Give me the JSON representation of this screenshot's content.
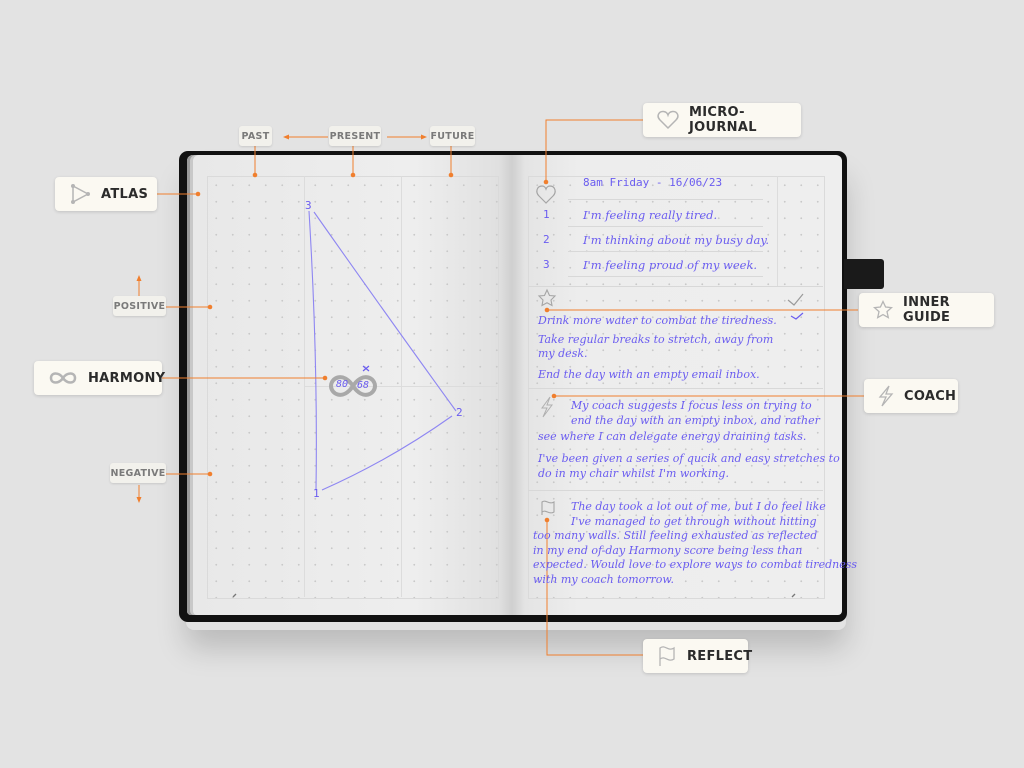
{
  "colors": {
    "accent": "#f07f2e",
    "ink": "#6a5cf0",
    "cover": "#111111",
    "label_bg": "#fbf9f2"
  },
  "time_axis": {
    "past": "PAST",
    "present": "PRESENT",
    "future": "FUTURE"
  },
  "mood_axis": {
    "positive": "POSITIVE",
    "negative": "NEGATIVE"
  },
  "sections": {
    "atlas": {
      "label": "ATLAS",
      "icon": "triangle-nodes-icon"
    },
    "harmony": {
      "label": "HARMONY",
      "icon": "infinity-icon"
    },
    "micro_journal": {
      "label": "MICRO-JOURNAL",
      "icon": "heart-icon"
    },
    "inner_guide": {
      "label": "INNER GUIDE",
      "icon": "star-icon"
    },
    "coach": {
      "label": "COACH",
      "icon": "lightning-icon"
    },
    "reflect": {
      "label": "REFLECT",
      "icon": "flag-icon"
    }
  },
  "atlas_chart": {
    "points": [
      {
        "label": "1"
      },
      {
        "label": "2"
      },
      {
        "label": "3"
      }
    ],
    "harmony_scores": {
      "left": "80",
      "right": "68"
    },
    "marker": "×"
  },
  "journal": {
    "date": "8am Friday - 16/06/23",
    "entries": [
      {
        "num": "1",
        "text": "I'm feeling really tired."
      },
      {
        "num": "2",
        "text": "I'm thinking about my busy day."
      },
      {
        "num": "3",
        "text": "I'm feeling proud of my week."
      }
    ]
  },
  "inner_guide": {
    "lines": [
      "Drink more water to combat the tiredness.",
      "Take regular breaks to stretch, away from",
      "my desk.",
      "End the day with an empty email inbox."
    ],
    "checks": [
      "done",
      "done"
    ]
  },
  "coach": {
    "lines": [
      "My coach suggests I focus less on trying to",
      "end the day with an empty inbox, and rather",
      "see where I can delegate energy draining tasks.",
      "I've been given a series of qucik and easy stretches to",
      "do in my chair whilst I'm working."
    ]
  },
  "reflect": {
    "lines": [
      "The day took a lot out of me, but I do feel like",
      "I've managed to get through without hitting",
      "too many walls. Still feeling exhausted as reflected",
      "in my end of-day Harmony score being less than",
      "expected. Would love to explore ways to combat tiredness",
      "with my coach tomorrow."
    ]
  }
}
